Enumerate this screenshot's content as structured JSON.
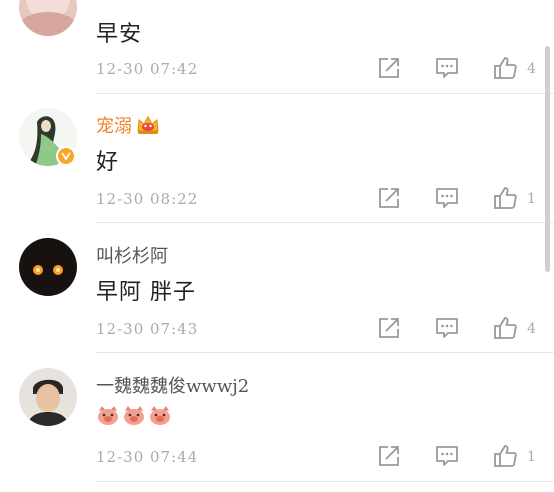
{
  "comments": [
    {
      "username": "",
      "text": "早安",
      "timestamp": "12-30 07:42",
      "likes": "4"
    },
    {
      "username": "宠溺",
      "text": "好",
      "timestamp": "12-30 08:22",
      "likes": "1"
    },
    {
      "username": "叫杉杉阿",
      "text": "早阿 胖子",
      "timestamp": "12-30 07:43",
      "likes": "4"
    },
    {
      "username": "一魏魏魏俊wwwj2",
      "text": "",
      "timestamp": "12-30 07:44",
      "likes": "1"
    }
  ],
  "icons": {
    "share": "share-icon",
    "comment": "comment-icon",
    "like": "thumbs-up-icon",
    "verified": "verified-badge-icon",
    "vip": "vip-crown-icon",
    "emoji": "pig-emoji-icon"
  },
  "colors": {
    "vip_name": "#f37f29",
    "badge": "#f5a623",
    "meta": "#aaaaaa",
    "divider": "#e7e7e7"
  }
}
